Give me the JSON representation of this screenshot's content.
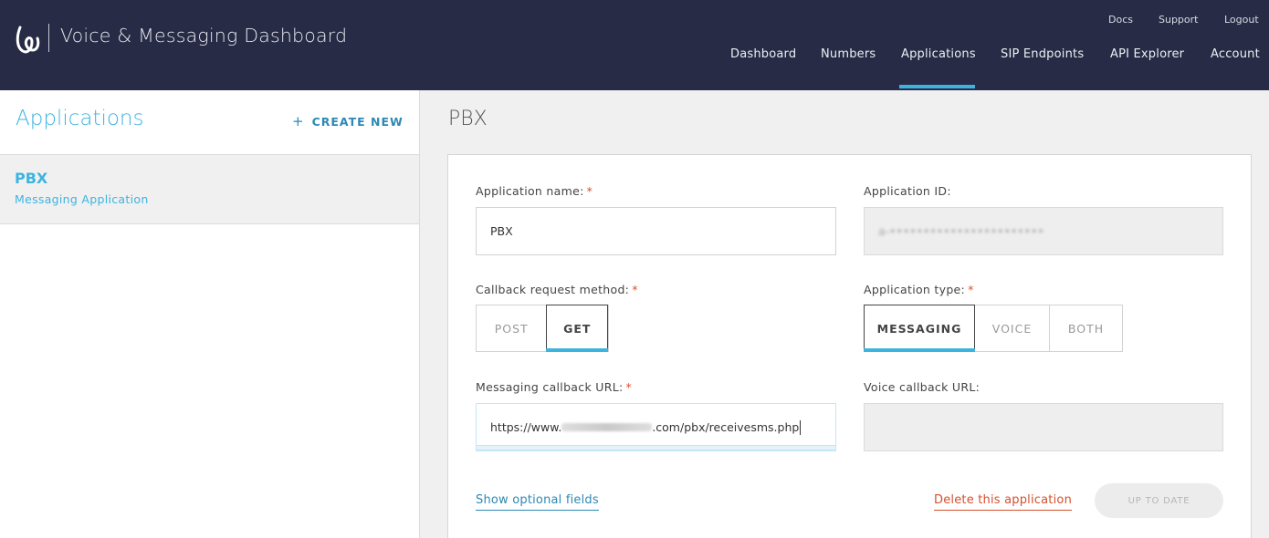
{
  "header": {
    "title": "Voice & Messaging Dashboard",
    "logo_icon": "bandwidth-logo-icon",
    "util_links": [
      "Docs",
      "Support",
      "Logout"
    ],
    "nav": [
      "Dashboard",
      "Numbers",
      "Applications",
      "SIP Endpoints",
      "API Explorer",
      "Account"
    ],
    "active_nav": "Applications",
    "bg_color": "#272b45",
    "accent_color": "#3eb3e0"
  },
  "sidebar": {
    "title": "Applications",
    "create_new_icon": "plus-icon",
    "create_new_label": "CREATE NEW",
    "items": [
      {
        "name": "PBX",
        "subtitle": "Messaging Application"
      }
    ]
  },
  "main": {
    "page_title": "PBX",
    "form": {
      "app_name_label": "Application name:",
      "app_name_value": "PBX",
      "app_id_label": "Application ID:",
      "app_id_value": "a-•••••••••••••••••••••••",
      "callback_method_label": "Callback request method:",
      "callback_methods": [
        "POST",
        "GET"
      ],
      "callback_method_selected": "GET",
      "app_type_label": "Application type:",
      "app_types": [
        "MESSAGING",
        "VOICE",
        "BOTH"
      ],
      "app_type_selected": "MESSAGING",
      "msg_callback_label": "Messaging callback URL:",
      "msg_callback_prefix": "https://www.",
      "msg_callback_suffix": ".com/pbx/receivesms.php",
      "voice_callback_label": "Voice callback URL:",
      "voice_callback_value": "",
      "required_marker": "*",
      "required_color": "#d4502c"
    },
    "show_optional_label": "Show optional fields",
    "delete_label": "Delete this application",
    "submit_label": "UP TO DATE"
  }
}
